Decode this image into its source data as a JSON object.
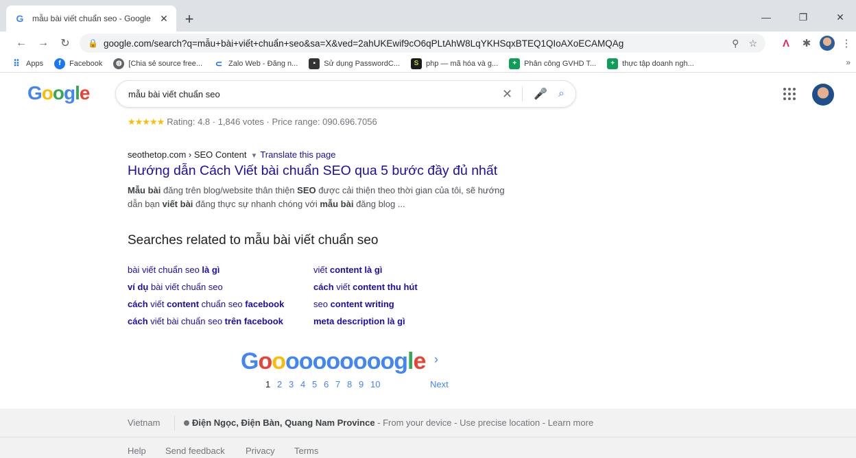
{
  "browser": {
    "tab_title": "mẫu bài viết chuẩn seo - Google",
    "url": "google.com/search?q=mẫu+bài+viết+chuẩn+seo&sa=X&ved=2ahUKEwif9cO6qPLtAhW8LqYKHSqxBTEQ1QIoAXoECAMQAg",
    "bookmarks": [
      {
        "label": "Apps"
      },
      {
        "label": "Facebook"
      },
      {
        "label": "[Chia sẻ source free..."
      },
      {
        "label": "Zalo Web - Đăng n..."
      },
      {
        "label": "Sử dụng PasswordC..."
      },
      {
        "label": "php — mã hóa và g..."
      },
      {
        "label": "Phân công GVHD T..."
      },
      {
        "label": "thực tập doanh ngh..."
      }
    ],
    "bookmarks_more": "»"
  },
  "search": {
    "query": "mẫu bài viết chuẩn seo"
  },
  "results": {
    "rating_text": "Rating: 4.8 · 1,846 votes · Price range: 090.696.7056",
    "stars": "★★★★★",
    "cite_domain": "seothetop.com › SEO Content",
    "translate": "Translate this page",
    "title": "Hướng dẫn Cách Viết bài chuẩn SEO qua 5 bước đầy đủ nhất",
    "snippet_html": {
      "line1_a": "Mẫu bài",
      "line1_b": " đăng trên blog/website thân thiện ",
      "line1_c": "SEO",
      "line1_d": " được cải thiện theo thời gian của tôi, sẽ hướng",
      "line2_a": "dẫn bạn ",
      "line2_b": "viết bài",
      "line2_c": " đăng thực sự nhanh chóng với ",
      "line2_d": "mẫu bài",
      "line2_e": " đăng blog ..."
    }
  },
  "related": {
    "heading": "Searches related to mẫu bài viết chuẩn seo",
    "left": [
      {
        "plain": "bài viết chuẩn seo ",
        "bold": "là gì"
      },
      {
        "bold": "ví dụ",
        "plain": " bài viết chuẩn seo"
      },
      {
        "bold1": "cách",
        "plain1": " viết ",
        "bold2": "content",
        "plain2": " chuẩn seo ",
        "bold3": "facebook"
      },
      {
        "bold1": "cách",
        "plain1": " viết bài chuẩn seo ",
        "bold2": "trên facebook"
      }
    ],
    "right": [
      {
        "plain": "viết ",
        "bold": "content là gì"
      },
      {
        "bold1": "cách",
        "plain1": " viết ",
        "bold2": "content thu hút"
      },
      {
        "plain": "seo ",
        "bold": "content writing"
      },
      {
        "bold": "meta description là gì"
      }
    ]
  },
  "pagination": {
    "logo_letters": [
      {
        "ch": "G",
        "color": "#4285f4"
      },
      {
        "ch": "o",
        "color": "#ea4335"
      },
      {
        "ch": "o",
        "color": "#fbbc05"
      },
      {
        "ch": "o",
        "color": "#4285f4"
      },
      {
        "ch": "o",
        "color": "#4285f4"
      },
      {
        "ch": "o",
        "color": "#4285f4"
      },
      {
        "ch": "o",
        "color": "#4285f4"
      },
      {
        "ch": "o",
        "color": "#4285f4"
      },
      {
        "ch": "o",
        "color": "#4285f4"
      },
      {
        "ch": "o",
        "color": "#4285f4"
      },
      {
        "ch": "o",
        "color": "#4285f4"
      },
      {
        "ch": "g",
        "color": "#4285f4"
      },
      {
        "ch": "l",
        "color": "#34a853"
      },
      {
        "ch": "e",
        "color": "#ea4335"
      }
    ],
    "pages": [
      "1",
      "2",
      "3",
      "4",
      "5",
      "6",
      "7",
      "8",
      "9",
      "10"
    ],
    "current": "1",
    "next": "Next"
  },
  "footer": {
    "country": "Vietnam",
    "location_bold": "Điện Ngọc, Điện Bàn, Quang Nam Province",
    "location_rest": " - From your device - Use precise location - Learn more",
    "links": [
      "Help",
      "Send feedback",
      "Privacy",
      "Terms"
    ]
  },
  "colors": {
    "link": "#1a0dab",
    "google_blue": "#4285f4",
    "google_red": "#ea4335",
    "google_yellow": "#fbbc05",
    "google_green": "#34a853"
  }
}
